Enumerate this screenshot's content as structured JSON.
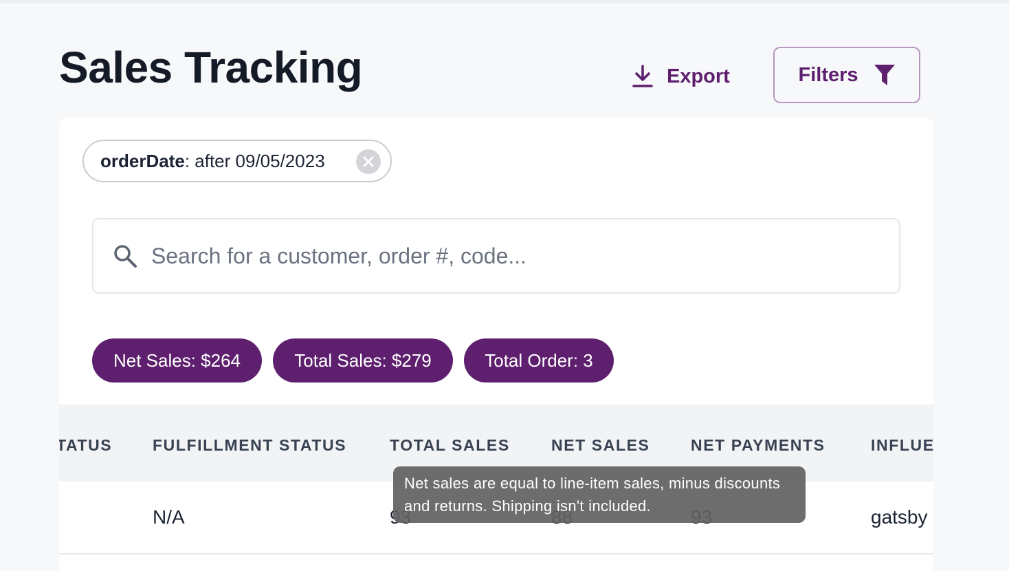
{
  "header": {
    "title": "Sales Tracking",
    "export_label": "Export",
    "filters_label": "Filters"
  },
  "filter_chip": {
    "key": "orderDate",
    "value": ": after 09/05/2023"
  },
  "search": {
    "placeholder": "Search for a customer, order #, code..."
  },
  "summary_pills": [
    {
      "label": "Net Sales: $264"
    },
    {
      "label": "Total Sales: $279"
    },
    {
      "label": "Total Order: 3"
    }
  ],
  "table": {
    "columns": [
      "TATUS",
      "FULFILLMENT STATUS",
      "TOTAL SALES",
      "NET SALES",
      "NET PAYMENTS",
      "INFLUE"
    ],
    "rows": [
      {
        "status": "",
        "fulfillment_status": "N/A",
        "total_sales": "93",
        "net_sales": "88",
        "net_payments": "93",
        "influencer": "gatsby"
      }
    ]
  },
  "tooltip": {
    "text": "Net sales are equal to line-item sales, minus discounts and returns. Shipping isn't included."
  },
  "colors": {
    "brand": "#5d1f6e",
    "brand_border": "#b896c2",
    "page_bg": "#f7f8fa"
  },
  "icons": [
    "download-icon",
    "funnel-icon",
    "close-icon",
    "search-icon"
  ]
}
